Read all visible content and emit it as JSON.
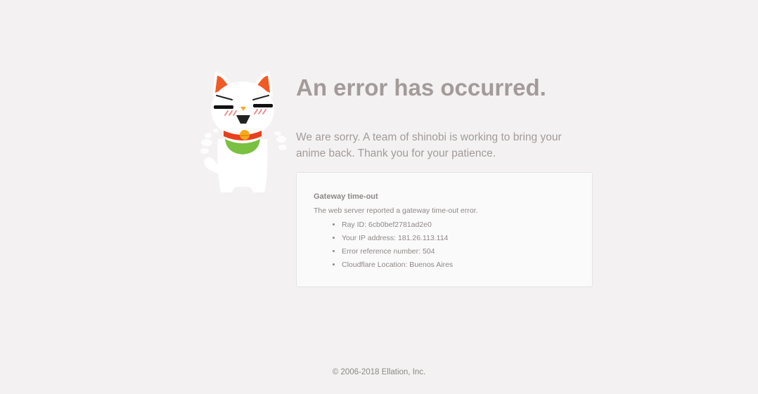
{
  "main": {
    "title": "An error has occurred.",
    "message": "We are sorry. A team of shinobi is working to bring your anime back. Thank you for your patience.",
    "mascot_icon": "lucky-cat-icon"
  },
  "error_box": {
    "heading": "Gateway time-out",
    "description": "The web server reported a gateway time-out error.",
    "details": [
      "Ray ID: 6cb0bef2781ad2e0",
      "Your IP address: 181.26.113.114",
      "Error reference number: 504",
      "Cloudflare Location: Buenos Aires"
    ]
  },
  "footer": {
    "copyright": "© 2006-2018 Ellation, Inc."
  },
  "colors": {
    "background": "#f3f1f1",
    "title_text": "#a39b9a",
    "body_text": "#8e8887",
    "box_background": "#fafafa",
    "box_border": "#e6e3e3",
    "cat_ear": "#f15a24",
    "cat_bib": "#7ac142",
    "cat_collar": "#e8401c",
    "cat_bell": "#f7a81b"
  }
}
